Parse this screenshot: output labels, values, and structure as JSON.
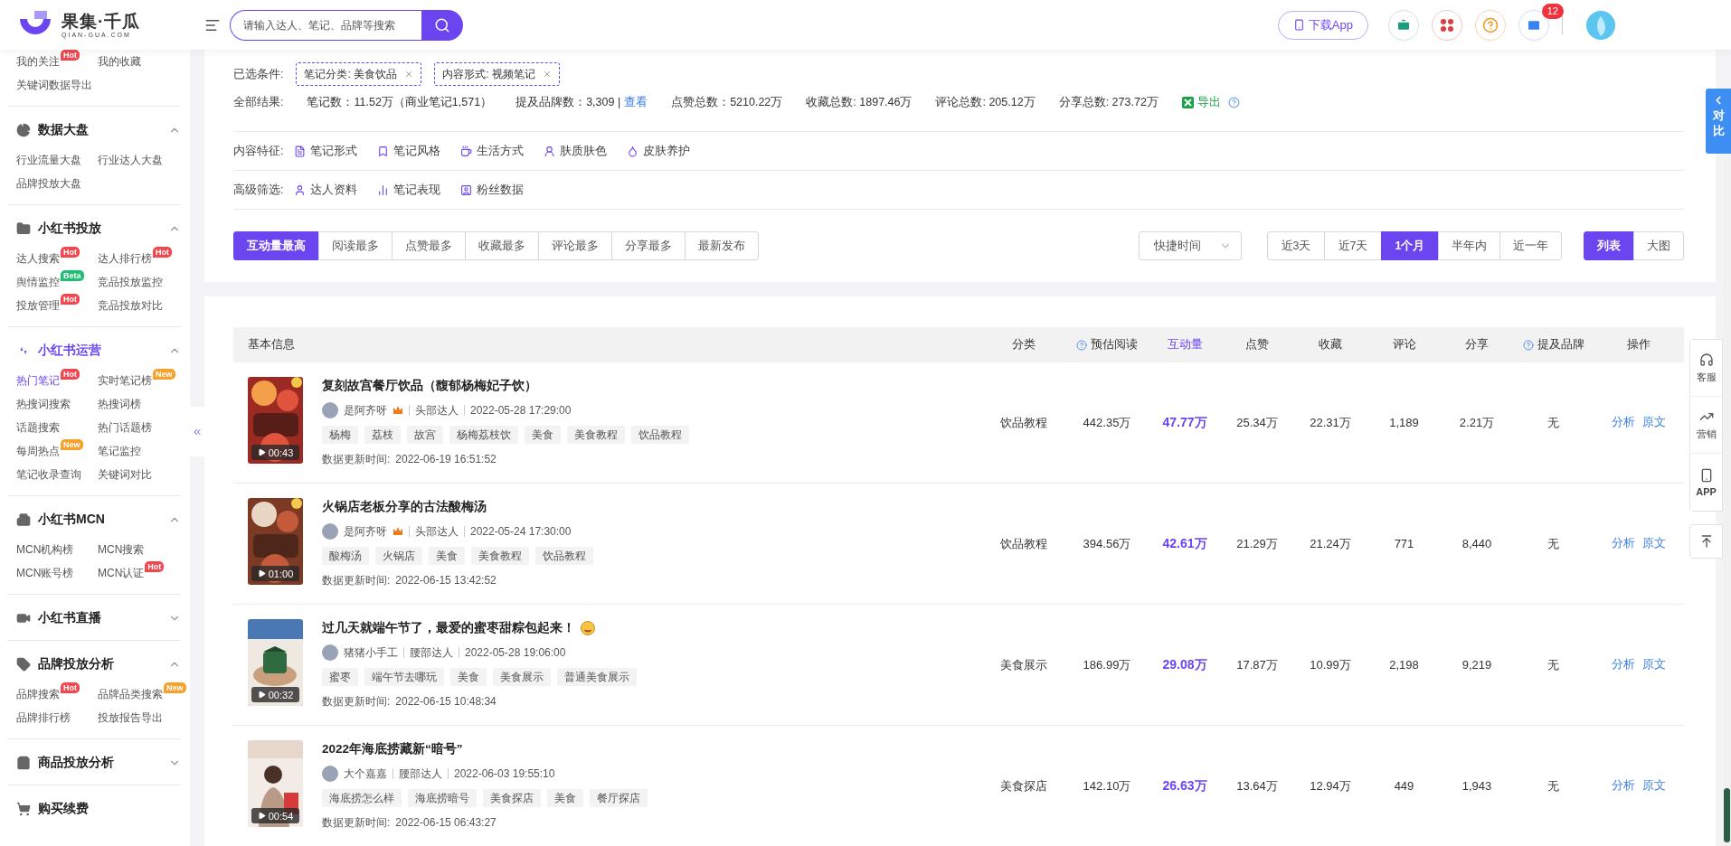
{
  "header": {
    "logo_name": "果集·千瓜",
    "logo_domain": "QIAN-GUA.COM",
    "search_placeholder": "请输入达人、笔记、品牌等搜索",
    "download_app": "下载App",
    "mail_count": "12"
  },
  "sidebar": {
    "top_links": [
      {
        "label": "我的关注",
        "selected": false,
        "badge": {
          "text": "Hot",
          "color": "#f2474f"
        }
      },
      {
        "label": "我的收藏",
        "selected": false
      },
      {
        "label": "关键词数据导出",
        "selected": false
      }
    ],
    "sections": [
      {
        "title": "数据大盘",
        "expanded": true,
        "selected": false,
        "items": [
          {
            "label": "行业流量大盘",
            "selected": false
          },
          {
            "label": "行业达人大盘",
            "selected": false
          },
          {
            "label": "品牌投放大盘",
            "selected": false
          }
        ]
      },
      {
        "title": "小红书投放",
        "expanded": true,
        "selected": false,
        "items": [
          {
            "label": "达人搜索",
            "selected": false,
            "badge": {
              "text": "Hot",
              "color": "#f2474f"
            }
          },
          {
            "label": "达人排行榜",
            "selected": false,
            "badge": {
              "text": "Hot",
              "color": "#f2474f"
            }
          },
          {
            "label": "舆情监控",
            "selected": false,
            "badge": {
              "text": "Beta",
              "color": "#1fbf73"
            }
          },
          {
            "label": "竞品投放监控",
            "selected": false
          },
          {
            "label": "投放管理",
            "selected": false,
            "badge": {
              "text": "Hot",
              "color": "#f2474f"
            }
          },
          {
            "label": "竞品投放对比",
            "selected": false
          }
        ]
      },
      {
        "title": "小红书运营",
        "expanded": true,
        "selected": true,
        "items": [
          {
            "label": "热门笔记",
            "selected": true,
            "badge": {
              "text": "Hot",
              "color": "#f2474f"
            }
          },
          {
            "label": "实时笔记榜",
            "selected": false,
            "badge": {
              "text": "New",
              "color": "#f7a12b"
            }
          },
          {
            "label": "热搜词搜索",
            "selected": false
          },
          {
            "label": "热搜词榜",
            "selected": false
          },
          {
            "label": "话题搜索",
            "selected": false
          },
          {
            "label": "热门话题榜",
            "selected": false
          },
          {
            "label": "每周热点",
            "selected": false,
            "badge": {
              "text": "New",
              "color": "#f7a12b"
            }
          },
          {
            "label": "笔记监控",
            "selected": false
          },
          {
            "label": "笔记收录查询",
            "selected": false
          },
          {
            "label": "关键词对比",
            "selected": false
          }
        ]
      },
      {
        "title": "小红书MCN",
        "expanded": true,
        "selected": false,
        "items": [
          {
            "label": "MCN机构榜",
            "selected": false
          },
          {
            "label": "MCN搜索",
            "selected": false
          },
          {
            "label": "MCN账号榜",
            "selected": false
          },
          {
            "label": "MCN认证",
            "selected": false,
            "badge": {
              "text": "Hot",
              "color": "#f2474f"
            }
          }
        ]
      },
      {
        "title": "小红书直播",
        "expanded": false,
        "selected": false
      },
      {
        "title": "品牌投放分析",
        "expanded": true,
        "selected": false,
        "items": [
          {
            "label": "品牌搜索",
            "selected": false,
            "badge": {
              "text": "Hot",
              "color": "#f2474f"
            }
          },
          {
            "label": "品牌品类搜索",
            "selected": false,
            "badge": {
              "text": "New",
              "color": "#f7a12b"
            }
          },
          {
            "label": "品牌排行榜",
            "selected": false
          },
          {
            "label": "投放报告导出",
            "selected": false
          }
        ]
      },
      {
        "title": "商品投放分析",
        "expanded": false,
        "selected": false
      },
      {
        "title": "购买续费",
        "kind": "link",
        "selected": false
      }
    ]
  },
  "filters": {
    "conditions_label": "已选条件:",
    "conditions": [
      "笔记分类: 美食饮品",
      "内容形式: 视频笔记"
    ],
    "summary_label": "全部结果:",
    "summary": [
      {
        "text": "笔记数：11.52万（商业笔记1,571）"
      },
      {
        "text": "提及品牌数：3,309 |",
        "link": "查看"
      },
      {
        "text": "点赞总数：5210.22万"
      },
      {
        "text": "收藏总数: 1897.46万"
      },
      {
        "text": "评论总数: 205.12万"
      },
      {
        "text": "分享总数: 273.72万"
      }
    ],
    "export": "导出",
    "rows": [
      {
        "label": "内容特征:",
        "items": [
          "笔记形式",
          "笔记风格",
          "生活方式",
          "肤质肤色",
          "皮肤养护"
        ]
      },
      {
        "label": "高级筛选:",
        "items": [
          "达人资料",
          "笔记表现",
          "粉丝数据"
        ]
      }
    ],
    "sort_tabs": [
      {
        "label": "互动量最高",
        "selected": true
      },
      {
        "label": "阅读最多",
        "selected": false
      },
      {
        "label": "点赞最多",
        "selected": false
      },
      {
        "label": "收藏最多",
        "selected": false
      },
      {
        "label": "评论最多",
        "selected": false
      },
      {
        "label": "分享最多",
        "selected": false
      },
      {
        "label": "最新发布",
        "selected": false
      }
    ],
    "time_select": "快捷时间",
    "range_tabs": [
      {
        "label": "近3天",
        "selected": false
      },
      {
        "label": "近7天",
        "selected": false
      },
      {
        "label": "1个月",
        "selected": true
      },
      {
        "label": "半年内",
        "selected": false
      },
      {
        "label": "近一年",
        "selected": false
      }
    ],
    "view_tabs": [
      {
        "label": "列表",
        "selected": true
      },
      {
        "label": "大图",
        "selected": false
      }
    ]
  },
  "table": {
    "columns": [
      {
        "label": "基本信息",
        "help": false,
        "selected": false
      },
      {
        "label": "分类",
        "help": false,
        "selected": false
      },
      {
        "label": "预估阅读",
        "help": true,
        "selected": false
      },
      {
        "label": "互动量",
        "help": false,
        "selected": true
      },
      {
        "label": "点赞",
        "help": false,
        "selected": false
      },
      {
        "label": "收藏",
        "help": false,
        "selected": false
      },
      {
        "label": "评论",
        "help": false,
        "selected": false
      },
      {
        "label": "分享",
        "help": false,
        "selected": false
      },
      {
        "label": "提及品牌",
        "help": true,
        "selected": false
      },
      {
        "label": "操作",
        "help": false,
        "selected": false
      }
    ],
    "rows": [
      {
        "title": "复刻故宫餐厅饮品（馥郁杨梅妃子饮）",
        "emoji": false,
        "author": "是阿齐呀",
        "verified": true,
        "tier": "头部达人",
        "published": "2022-05-28 17:29:00",
        "tags": [
          "杨梅",
          "荔枝",
          "故宫",
          "杨梅荔枝饮",
          "美食",
          "美食教程",
          "饮品教程"
        ],
        "updated_label": "数据更新时间:",
        "updated": "2022-06-19 16:51:52",
        "duration": "00:43",
        "category": "饮品教程",
        "reads": "442.35万",
        "interactions": "47.77万",
        "likes": "25.34万",
        "collects": "22.31万",
        "comments": "1,189",
        "shares": "2.21万",
        "brands": "无",
        "actions": [
          "分析",
          "原文"
        ]
      },
      {
        "title": "火锅店老板分享的古法酸梅汤",
        "emoji": false,
        "author": "是阿齐呀",
        "verified": true,
        "tier": "头部达人",
        "published": "2022-05-24 17:30:00",
        "tags": [
          "酸梅汤",
          "火锅店",
          "美食",
          "美食教程",
          "饮品教程"
        ],
        "updated_label": "数据更新时间:",
        "updated": "2022-06-15 13:42:52",
        "duration": "01:00",
        "category": "饮品教程",
        "reads": "394.56万",
        "interactions": "42.61万",
        "likes": "21.29万",
        "collects": "21.24万",
        "comments": "771",
        "shares": "8,440",
        "brands": "无",
        "actions": [
          "分析",
          "原文"
        ]
      },
      {
        "title": "过几天就端午节了，最爱的蜜枣甜粽包起来！",
        "emoji": true,
        "author": "猪猪小手工",
        "verified": false,
        "tier": "腰部达人",
        "published": "2022-05-28 19:06:00",
        "tags": [
          "蜜枣",
          "端午节去哪玩",
          "美食",
          "美食展示",
          "普通美食展示"
        ],
        "updated_label": "数据更新时间:",
        "updated": "2022-06-15 10:48:34",
        "duration": "00:32",
        "category": "美食展示",
        "reads": "186.99万",
        "interactions": "29.08万",
        "likes": "17.87万",
        "collects": "10.99万",
        "comments": "2,198",
        "shares": "9,219",
        "brands": "无",
        "actions": [
          "分析",
          "原文"
        ]
      },
      {
        "title": "2022年海底捞藏新“暗号”",
        "emoji": false,
        "author": "大个嘉嘉",
        "verified": false,
        "tier": "腰部达人",
        "published": "2022-06-03 19:55:10",
        "tags": [
          "海底捞怎么样",
          "海底捞暗号",
          "美食探店",
          "美食",
          "餐厅探店"
        ],
        "updated_label": "数据更新时间:",
        "updated": "2022-06-15 06:43:27",
        "duration": "00:54",
        "category": "美食探店",
        "reads": "142.10万",
        "interactions": "26.63万",
        "likes": "13.64万",
        "collects": "12.94万",
        "comments": "449",
        "shares": "1,943",
        "brands": "无",
        "actions": [
          "分析",
          "原文"
        ]
      }
    ]
  },
  "compare_tab": "对比",
  "side_tools": [
    "客服",
    "营销",
    "APP"
  ]
}
